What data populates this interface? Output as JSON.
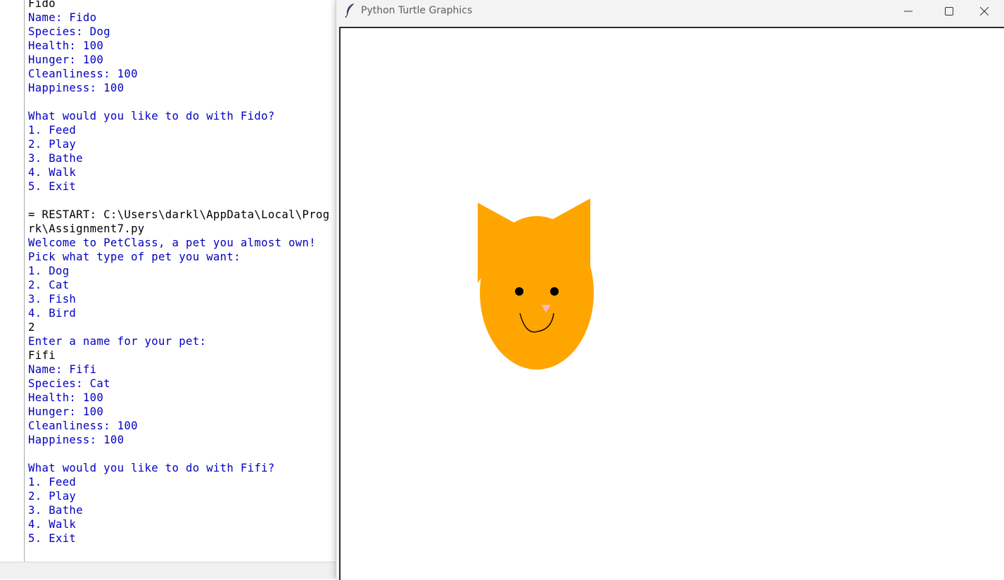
{
  "shell": {
    "lines": [
      {
        "text": "Fido",
        "kind": "in"
      },
      {
        "text": "Name: Fido",
        "kind": "out"
      },
      {
        "text": "Species: Dog",
        "kind": "out"
      },
      {
        "text": "Health: 100",
        "kind": "out"
      },
      {
        "text": "Hunger: 100",
        "kind": "out"
      },
      {
        "text": "Cleanliness: 100",
        "kind": "out"
      },
      {
        "text": "Happiness: 100",
        "kind": "out"
      },
      {
        "text": "",
        "kind": "out"
      },
      {
        "text": "What would you like to do with Fido?",
        "kind": "out"
      },
      {
        "text": "1. Feed",
        "kind": "out"
      },
      {
        "text": "2. Play",
        "kind": "out"
      },
      {
        "text": "3. Bathe",
        "kind": "out"
      },
      {
        "text": "4. Walk",
        "kind": "out"
      },
      {
        "text": "5. Exit",
        "kind": "out"
      },
      {
        "text": "",
        "kind": "out"
      },
      {
        "text": "= RESTART: C:\\Users\\darkl\\AppData\\Local\\Prog",
        "kind": "sys"
      },
      {
        "text": "rk\\Assignment7.py",
        "kind": "sys"
      },
      {
        "text": "Welcome to PetClass, a pet you almost own!",
        "kind": "out"
      },
      {
        "text": "Pick what type of pet you want:",
        "kind": "out"
      },
      {
        "text": "1. Dog",
        "kind": "out"
      },
      {
        "text": "2. Cat",
        "kind": "out"
      },
      {
        "text": "3. Fish",
        "kind": "out"
      },
      {
        "text": "4. Bird",
        "kind": "out"
      },
      {
        "text": "2",
        "kind": "in"
      },
      {
        "text": "Enter a name for your pet:",
        "kind": "out"
      },
      {
        "text": "Fifi",
        "kind": "in"
      },
      {
        "text": "Name: Fifi",
        "kind": "out"
      },
      {
        "text": "Species: Cat",
        "kind": "out"
      },
      {
        "text": "Health: 100",
        "kind": "out"
      },
      {
        "text": "Hunger: 100",
        "kind": "out"
      },
      {
        "text": "Cleanliness: 100",
        "kind": "out"
      },
      {
        "text": "Happiness: 100",
        "kind": "out"
      },
      {
        "text": "",
        "kind": "out"
      },
      {
        "text": "What would you like to do with Fifi?",
        "kind": "out"
      },
      {
        "text": "1. Feed",
        "kind": "out"
      },
      {
        "text": "2. Play",
        "kind": "out"
      },
      {
        "text": "3. Bathe",
        "kind": "out"
      },
      {
        "text": "4. Walk",
        "kind": "out"
      },
      {
        "text": "5. Exit",
        "kind": "out"
      }
    ]
  },
  "turtle_window": {
    "title": "Python Turtle Graphics",
    "icon": "feather-icon",
    "buttons": [
      "minimize-icon",
      "maximize-icon",
      "close-icon"
    ]
  },
  "drawing": {
    "subject": "cat-face",
    "colors": {
      "face": "#ffa500",
      "eyes": "#000000",
      "nose": "#ffb6c1",
      "mouth": "#000000"
    }
  }
}
